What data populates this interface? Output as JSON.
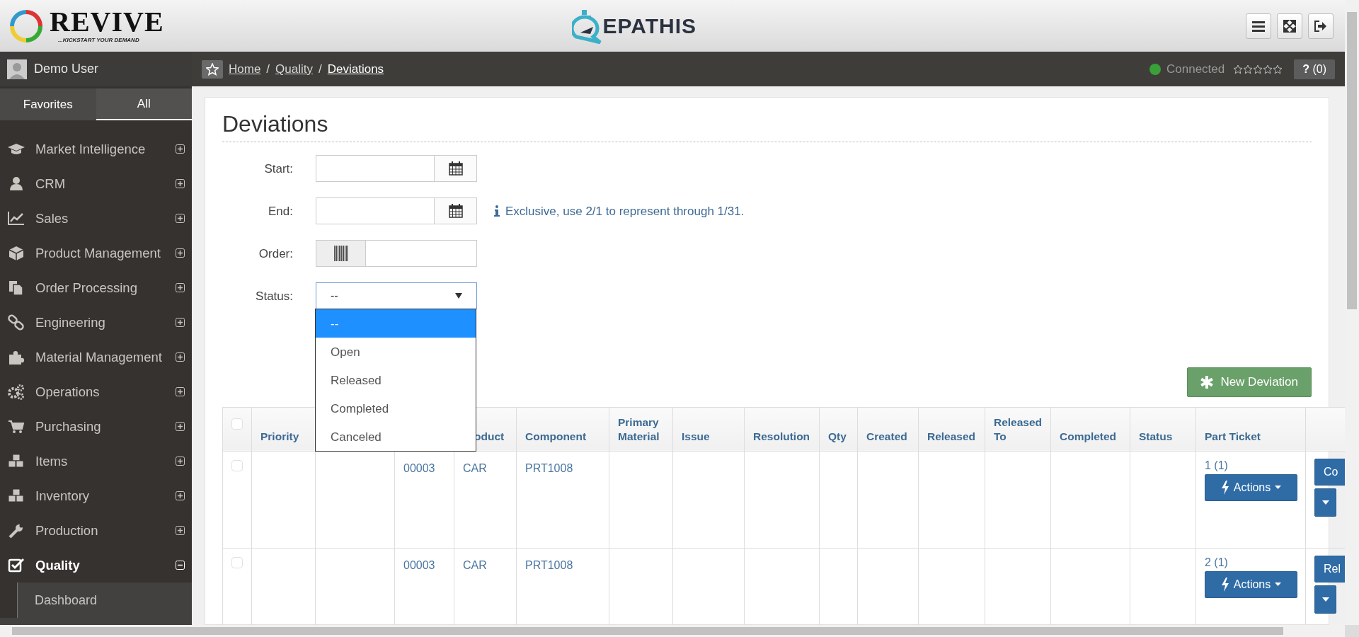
{
  "header": {
    "brand": "REVIVE",
    "tagline": "...KICKSTART YOUR DEMAND",
    "center_logo": "EPATHIS"
  },
  "user": {
    "name": "Demo User"
  },
  "breadcrumb": {
    "items": [
      "Home",
      "Quality",
      "Deviations"
    ],
    "separator": "/"
  },
  "connection": {
    "label": "Connected",
    "color": "#3aa03a"
  },
  "rating": {
    "stars": 0
  },
  "help": {
    "label": "?",
    "count": "(0)"
  },
  "sidebar": {
    "tabs": [
      {
        "label": "Favorites",
        "selected": false
      },
      {
        "label": "All",
        "selected": true
      }
    ],
    "items": [
      {
        "label": "Market Intelligence",
        "expanded": false,
        "selected": false
      },
      {
        "label": "CRM",
        "expanded": false,
        "selected": false
      },
      {
        "label": "Sales",
        "expanded": false,
        "selected": false
      },
      {
        "label": "Product Management",
        "expanded": false,
        "selected": false
      },
      {
        "label": "Order Processing",
        "expanded": false,
        "selected": false
      },
      {
        "label": "Engineering",
        "expanded": false,
        "selected": false
      },
      {
        "label": "Material Management",
        "expanded": false,
        "selected": false
      },
      {
        "label": "Operations",
        "expanded": false,
        "selected": false
      },
      {
        "label": "Purchasing",
        "expanded": false,
        "selected": false
      },
      {
        "label": "Items",
        "expanded": false,
        "selected": false
      },
      {
        "label": "Inventory",
        "expanded": false,
        "selected": false
      },
      {
        "label": "Production",
        "expanded": false,
        "selected": false
      },
      {
        "label": "Quality",
        "expanded": true,
        "selected": true,
        "children": [
          {
            "label": "Dashboard"
          }
        ]
      }
    ]
  },
  "page": {
    "title": "Deviations"
  },
  "filters": [
    {
      "kind": "date",
      "label": "Start:"
    },
    {
      "kind": "date",
      "label": "End:",
      "hint": "Exclusive, use 2/1 to represent through 1/31."
    },
    {
      "kind": "barcode",
      "label": "Order:"
    },
    {
      "kind": "select",
      "label": "Status:",
      "value": "--",
      "open": true,
      "options": [
        {
          "label": "--",
          "selected": true
        },
        {
          "label": "Open",
          "selected": false
        },
        {
          "label": "Released",
          "selected": false
        },
        {
          "label": "Completed",
          "selected": false
        },
        {
          "label": "Canceled",
          "selected": false
        }
      ]
    }
  ],
  "new_button": {
    "label": "New Deviation"
  },
  "table": {
    "select_all": {
      "checked": false
    },
    "columns": [
      "Priority",
      null,
      null,
      "oduct",
      "Component",
      "Primary Material",
      "Issue",
      "Resolution",
      "Qty",
      "Created",
      "Released",
      "Released To",
      "Completed",
      "Status",
      "Part Ticket",
      null
    ],
    "rows": [
      {
        "checked": false,
        "cells": [
          null,
          null,
          "00003",
          "CAR",
          "PRT1008",
          null,
          null,
          null,
          null,
          null,
          null,
          null,
          null,
          null
        ],
        "part_ticket": "1 (1)",
        "actions": "Actions",
        "side_button": "Co"
      },
      {
        "checked": false,
        "cells": [
          null,
          null,
          "00003",
          "CAR",
          "PRT1008",
          null,
          null,
          null,
          null,
          null,
          null,
          null,
          null,
          null
        ],
        "part_ticket": "2 (1)",
        "actions": "Actions",
        "side_button": "Rel"
      }
    ]
  }
}
